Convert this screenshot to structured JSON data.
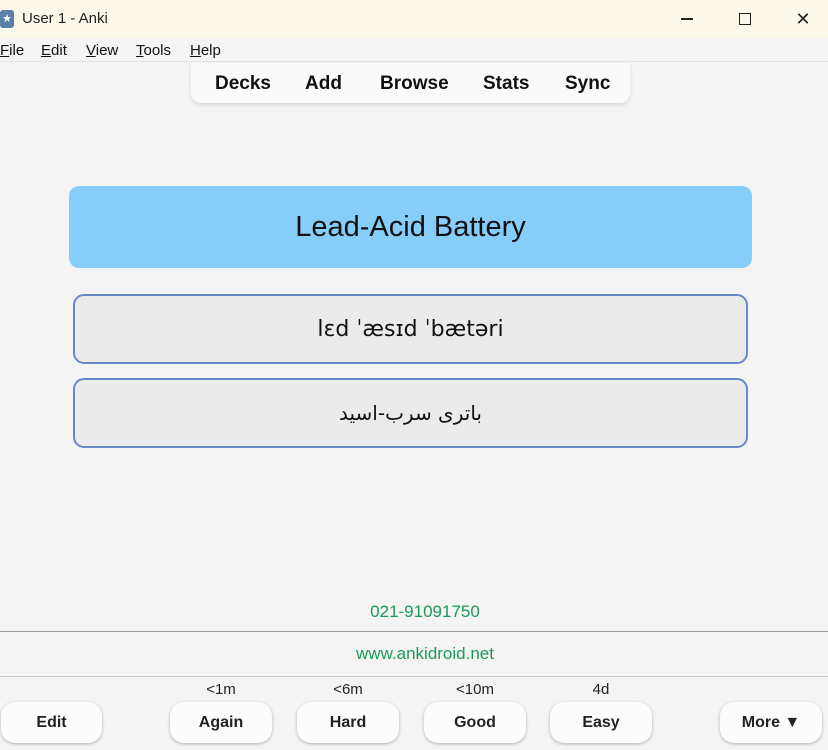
{
  "window": {
    "title": "User 1 - Anki",
    "minimize": "",
    "maximize": "",
    "close": "✕"
  },
  "menu": [
    "File",
    "Edit",
    "View",
    "Tools",
    "Help"
  ],
  "toolbar": [
    "Decks",
    "Add",
    "Browse",
    "Stats",
    "Sync"
  ],
  "card": {
    "front": "Lead-Acid Battery",
    "phonetic": "lɛd ˈæsɪd ˈbætəri",
    "translation": "باتری سرب-اسید"
  },
  "footer": {
    "phone": "021-91091750",
    "website": "www.ankidroid.net"
  },
  "answers": {
    "edit": "Edit",
    "again": {
      "label": "Again",
      "interval": "<1m"
    },
    "hard": {
      "label": "Hard",
      "interval": "<6m"
    },
    "good": {
      "label": "Good",
      "interval": "<10m"
    },
    "easy": {
      "label": "Easy",
      "interval": "4d"
    },
    "more": "More ▼"
  },
  "colors": {
    "front_bg": "#87cdf9",
    "answer_border": "#6b88c6",
    "link_green": "#1a9a5a",
    "titlebar_bg": "#fbf7ea"
  }
}
